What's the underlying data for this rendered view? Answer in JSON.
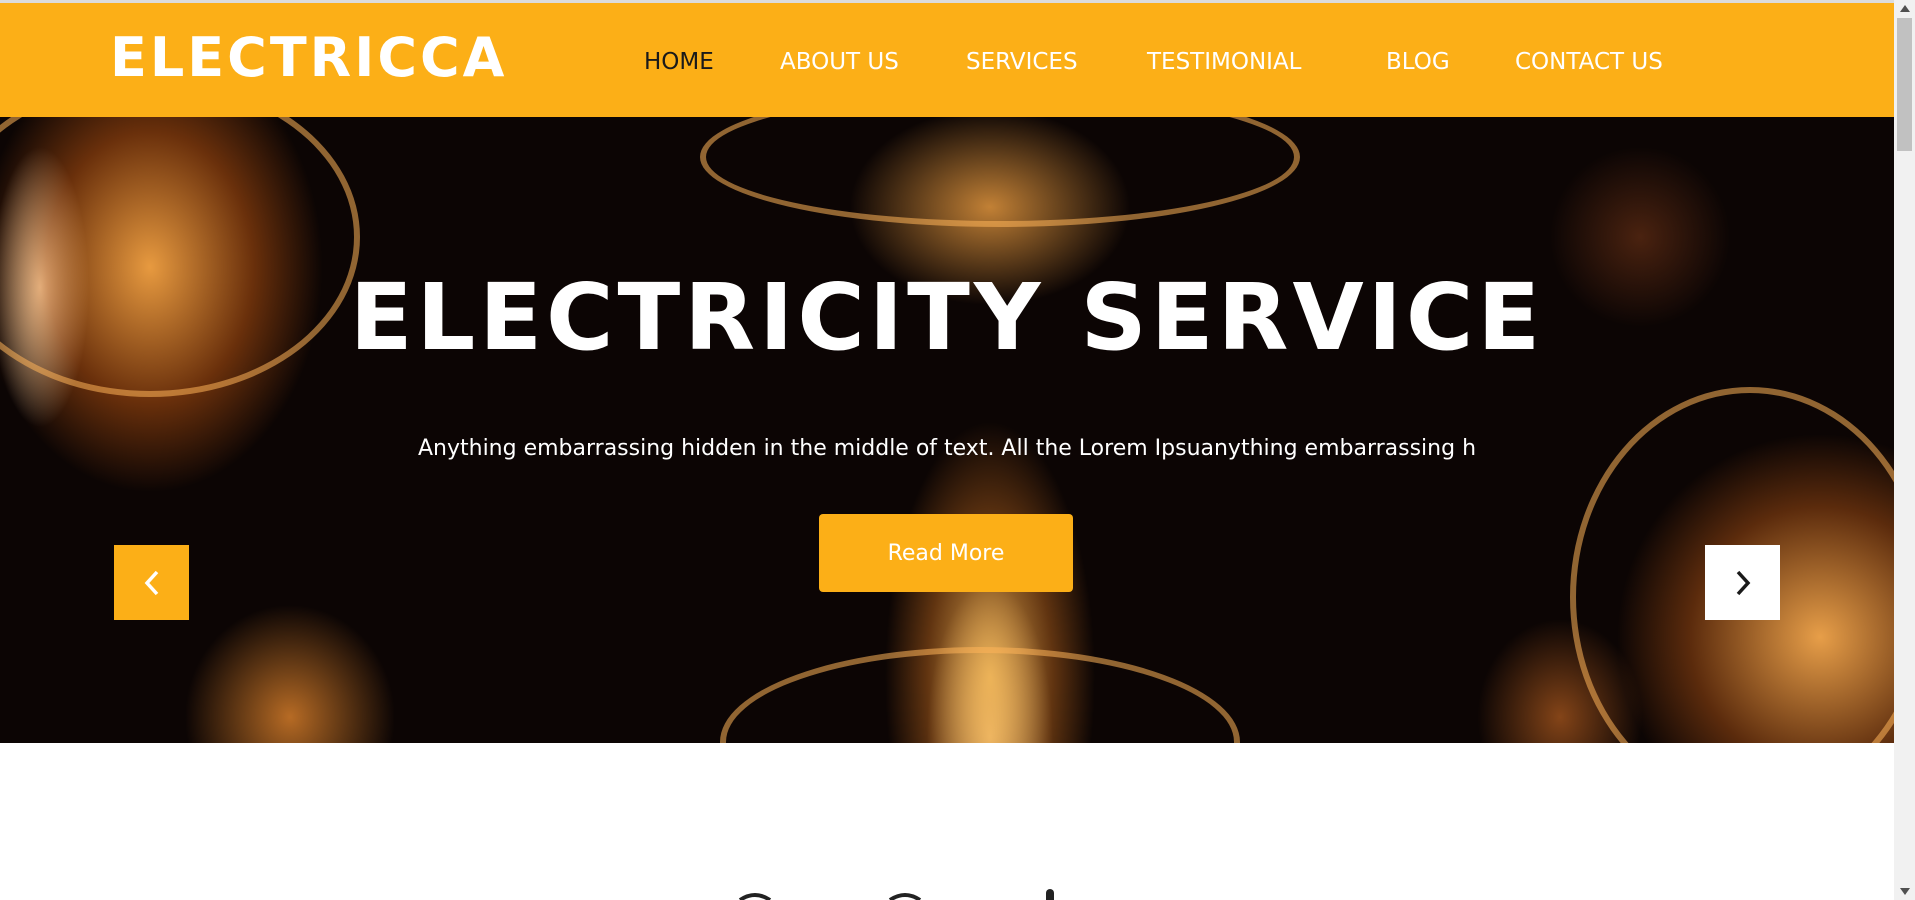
{
  "header": {
    "logo": "ELECTRICCA",
    "nav": [
      {
        "label": "HOME",
        "active": true
      },
      {
        "label": "ABOUT US",
        "active": false
      },
      {
        "label": "SERVICES",
        "active": false
      },
      {
        "label": "TESTIMONIAL",
        "active": false
      },
      {
        "label": "BLOG",
        "active": false
      },
      {
        "label": "CONTACT US",
        "active": false
      }
    ]
  },
  "hero": {
    "title": "ELECTRICITY SERVICE",
    "text": "Anything embarrassing hidden in the middle of text. All the Lorem Ipsuanything embarrassing h",
    "button_label": "Read More",
    "prev_icon": "chevron-left-icon",
    "next_icon": "chevron-right-icon"
  },
  "colors": {
    "accent": "#fcaf17",
    "nav_active": "#1a1a1a",
    "text_light": "#ffffff"
  }
}
